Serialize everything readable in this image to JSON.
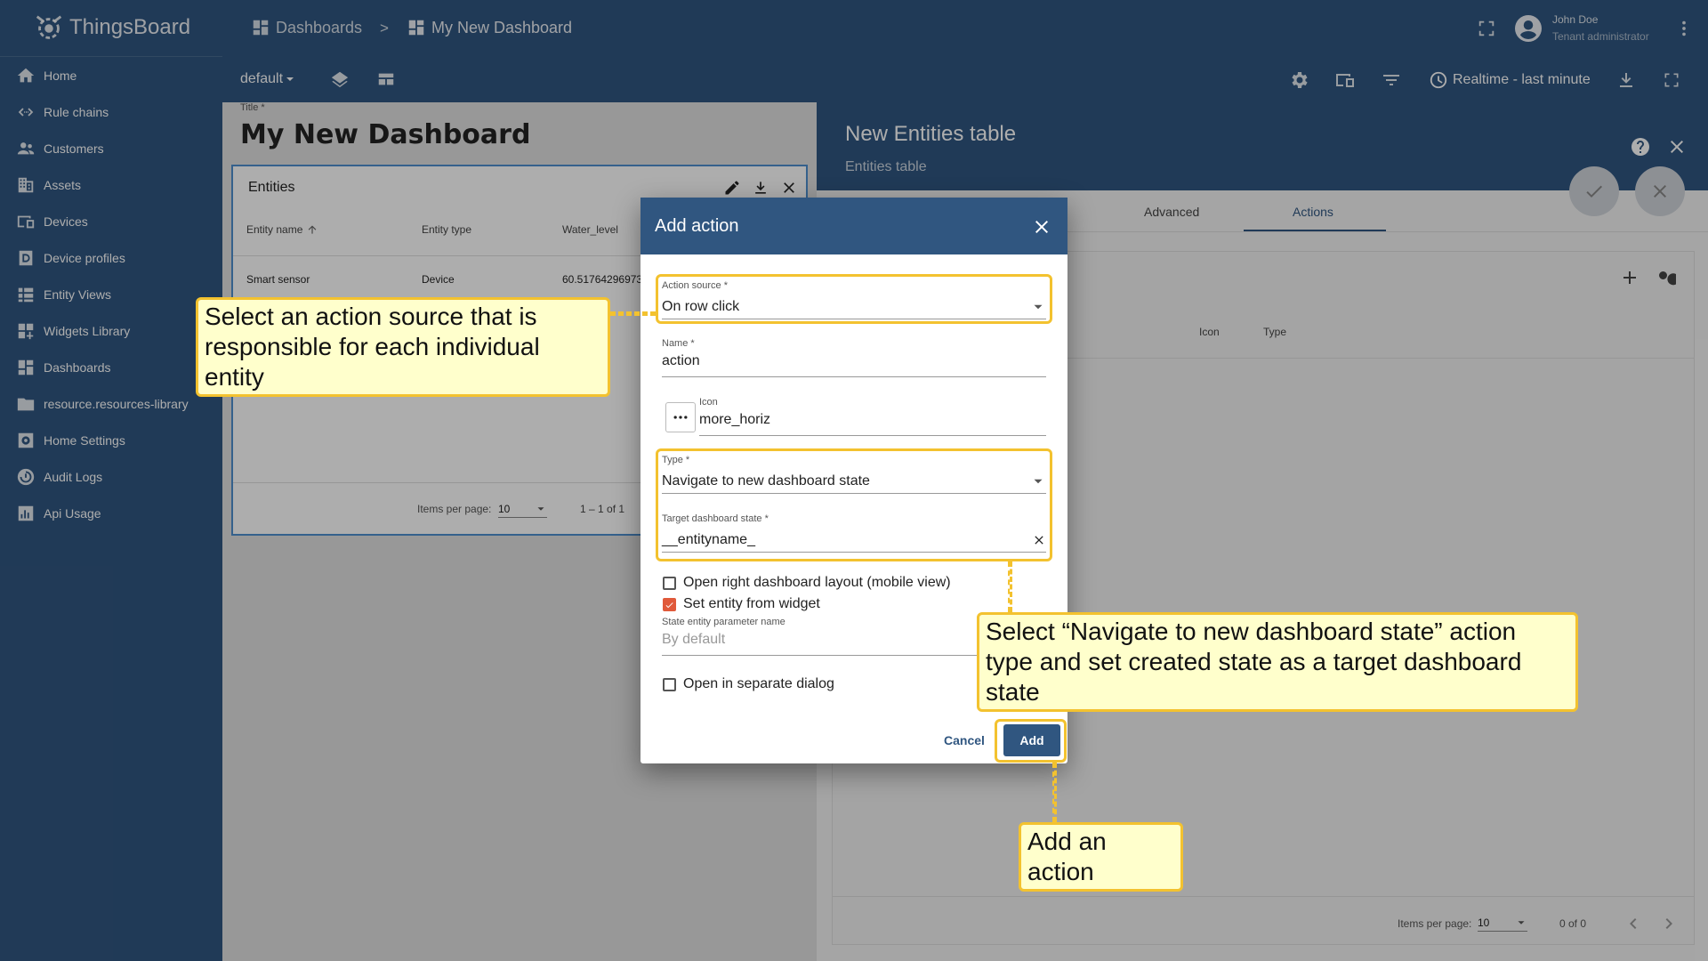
{
  "app": {
    "name": "ThingsBoard"
  },
  "sidebar": {
    "items": [
      {
        "label": "Home",
        "icon": "home-icon"
      },
      {
        "label": "Rule chains",
        "icon": "rule-chains-icon"
      },
      {
        "label": "Customers",
        "icon": "customers-icon"
      },
      {
        "label": "Assets",
        "icon": "assets-icon"
      },
      {
        "label": "Devices",
        "icon": "devices-icon"
      },
      {
        "label": "Device profiles",
        "icon": "device-profiles-icon"
      },
      {
        "label": "Entity Views",
        "icon": "entity-views-icon"
      },
      {
        "label": "Widgets Library",
        "icon": "widgets-icon"
      },
      {
        "label": "Dashboards",
        "icon": "dashboards-icon"
      },
      {
        "label": "resource.resources-library",
        "icon": "folder-icon"
      },
      {
        "label": "Home Settings",
        "icon": "settings-icon"
      },
      {
        "label": "Audit Logs",
        "icon": "audit-icon"
      },
      {
        "label": "Api Usage",
        "icon": "chart-icon"
      }
    ]
  },
  "header": {
    "breadcrumb_1": "Dashboards",
    "breadcrumb_sep": ">",
    "breadcrumb_2": "My New Dashboard",
    "user_name": "John Doe",
    "user_role": "Tenant administrator",
    "state_select": "default",
    "timewindow": "Realtime - last minute"
  },
  "dashboard": {
    "title_label": "Title *",
    "title": "My New Dashboard",
    "widget": {
      "title": "Entities",
      "columns": [
        "Entity name",
        "Entity type",
        "Water_level"
      ],
      "row": [
        "Smart sensor",
        "Device",
        "60.51764296973"
      ],
      "items_per_page_label": "Items per page:",
      "items_per_page": "10",
      "range": "1 – 1 of 1"
    }
  },
  "panel": {
    "title": "New Entities table",
    "subtitle": "Entities table",
    "tabs": [
      "Advanced",
      "Actions"
    ],
    "columns": [
      "Icon",
      "Type"
    ],
    "items_per_page_label": "Items per page:",
    "items_per_page": "10",
    "range": "0 of 0"
  },
  "dialog": {
    "title": "Add action",
    "action_source_label": "Action source *",
    "action_source": "On row click",
    "name_label": "Name *",
    "name": "action",
    "icon_label": "Icon",
    "icon_value": "more_horiz",
    "type_label": "Type *",
    "type": "Navigate to new dashboard state",
    "target_label": "Target dashboard state *",
    "target": "__entityname_",
    "cb_right_layout": "Open right dashboard layout (mobile view)",
    "cb_right_layout_checked": false,
    "cb_set_entity": "Set entity from widget",
    "cb_set_entity_checked": true,
    "state_param_label": "State entity parameter name",
    "state_param_placeholder": "By default",
    "cb_separate_dialog": "Open in separate dialog",
    "cb_separate_dialog_checked": false,
    "cancel": "Cancel",
    "add": "Add"
  },
  "callouts": {
    "source": "Select an action source that is responsible for each individual entity",
    "type": "Select “Navigate to new dashboard state” action type and set created state as a target dashboard state",
    "add": "Add an action"
  },
  "colors": {
    "primary": "#305680",
    "highlight": "#f3c22f",
    "callout_bg": "#ffffcc",
    "checkbox": "#e0593a"
  }
}
